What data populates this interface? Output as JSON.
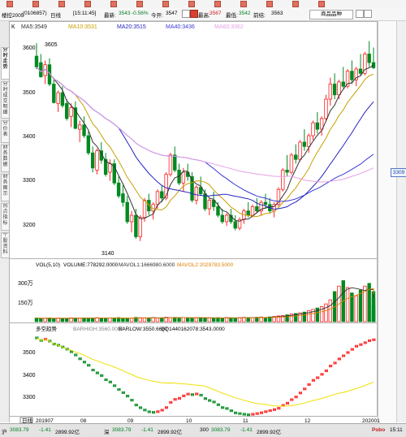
{
  "infobar": {
    "code": "楼控2005",
    "date_range": "(0106857)",
    "period": "日线",
    "time": "[15:11:45]",
    "latest_label": "最新:",
    "latest": "3543",
    "change": "-0.56%",
    "open_label": "今开:",
    "open": "3547",
    "high_label": "最高:",
    "high": "3567",
    "low_label": "最低:",
    "low": "3542",
    "prev_label": "前结:",
    "prev": "3563",
    "products_button": "商品品种"
  },
  "sidebar_tabs": [
    "分时走势",
    "分时成交明细",
    "分价表",
    "财务数据",
    "财务图示",
    "热点指标",
    "个股资料"
  ],
  "price_tag": "3309",
  "colors": {
    "up": "#ff2020",
    "down": "#008a20",
    "ma5": "#333333",
    "ma10": "#c8a000",
    "ma20": "#2424c0",
    "ma40": "#3a3ad8",
    "ma60": "#e6a0e6",
    "vol_ma1": "#303030",
    "vol_ma2": "#e08000",
    "barhigh": "#f0e000"
  },
  "chart_data": [
    {
      "type": "candlestick",
      "legend": {
        "k": "K",
        "ma5": "MA5:3549",
        "ma10": "MA10:3531",
        "ma20": "MA20:3515",
        "ma40": "MA40:3436",
        "ma60": "MA60:3362"
      },
      "y_ticks": [
        "3600",
        "3500",
        "3400",
        "3300",
        "3200"
      ],
      "ylim": [
        3115,
        3625
      ],
      "annotations": {
        "high": "3605",
        "low": "3140"
      },
      "candles": [
        [
          3570,
          3600,
          3540,
          3545
        ],
        [
          3555,
          3575,
          3520,
          3522
        ],
        [
          3525,
          3560,
          3505,
          3550
        ],
        [
          3550,
          3565,
          3500,
          3505
        ],
        [
          3505,
          3520,
          3460,
          3462
        ],
        [
          3460,
          3490,
          3440,
          3485
        ],
        [
          3485,
          3500,
          3450,
          3455
        ],
        [
          3460,
          3470,
          3420,
          3425
        ],
        [
          3430,
          3460,
          3405,
          3450
        ],
        [
          3450,
          3465,
          3400,
          3402
        ],
        [
          3400,
          3420,
          3370,
          3410
        ],
        [
          3410,
          3430,
          3380,
          3385
        ],
        [
          3385,
          3395,
          3340,
          3345
        ],
        [
          3345,
          3360,
          3300,
          3310
        ],
        [
          3305,
          3355,
          3295,
          3350
        ],
        [
          3350,
          3370,
          3320,
          3328
        ],
        [
          3330,
          3345,
          3290,
          3295
        ],
        [
          3300,
          3330,
          3280,
          3320
        ],
        [
          3320,
          3330,
          3270,
          3275
        ],
        [
          3275,
          3290,
          3240,
          3245
        ],
        [
          3250,
          3270,
          3220,
          3230
        ],
        [
          3230,
          3245,
          3180,
          3185
        ],
        [
          3185,
          3210,
          3160,
          3200
        ],
        [
          3200,
          3215,
          3145,
          3150
        ],
        [
          3150,
          3200,
          3140,
          3195
        ],
        [
          3195,
          3240,
          3185,
          3235
        ],
        [
          3235,
          3250,
          3200,
          3210
        ],
        [
          3210,
          3230,
          3190,
          3225
        ],
        [
          3225,
          3260,
          3215,
          3255
        ],
        [
          3255,
          3270,
          3230,
          3240
        ],
        [
          3240,
          3300,
          3235,
          3295
        ],
        [
          3295,
          3345,
          3290,
          3340
        ],
        [
          3340,
          3360,
          3300,
          3305
        ],
        [
          3305,
          3320,
          3270,
          3275
        ],
        [
          3275,
          3310,
          3255,
          3300
        ],
        [
          3300,
          3320,
          3280,
          3290
        ],
        [
          3290,
          3300,
          3230,
          3235
        ],
        [
          3235,
          3270,
          3225,
          3265
        ],
        [
          3265,
          3290,
          3245,
          3250
        ],
        [
          3250,
          3260,
          3210,
          3215
        ],
        [
          3215,
          3240,
          3200,
          3235
        ],
        [
          3235,
          3255,
          3210,
          3220
        ],
        [
          3220,
          3230,
          3195,
          3200
        ],
        [
          3200,
          3215,
          3180,
          3185
        ],
        [
          3185,
          3205,
          3175,
          3200
        ],
        [
          3200,
          3215,
          3180,
          3185
        ],
        [
          3185,
          3200,
          3165,
          3170
        ],
        [
          3170,
          3195,
          3165,
          3190
        ],
        [
          3190,
          3215,
          3180,
          3210
        ],
        [
          3210,
          3230,
          3195,
          3200
        ],
        [
          3200,
          3225,
          3195,
          3220
        ],
        [
          3220,
          3240,
          3205,
          3210
        ],
        [
          3210,
          3235,
          3200,
          3230
        ],
        [
          3230,
          3250,
          3215,
          3225
        ],
        [
          3225,
          3240,
          3205,
          3210
        ],
        [
          3210,
          3230,
          3195,
          3225
        ],
        [
          3225,
          3265,
          3220,
          3260
        ],
        [
          3260,
          3310,
          3255,
          3305
        ],
        [
          3305,
          3340,
          3290,
          3300
        ],
        [
          3300,
          3345,
          3295,
          3340
        ],
        [
          3340,
          3365,
          3320,
          3330
        ],
        [
          3330,
          3375,
          3325,
          3370
        ],
        [
          3370,
          3400,
          3350,
          3360
        ],
        [
          3360,
          3390,
          3345,
          3385
        ],
        [
          3385,
          3420,
          3375,
          3415
        ],
        [
          3415,
          3440,
          3390,
          3400
        ],
        [
          3400,
          3430,
          3385,
          3425
        ],
        [
          3425,
          3480,
          3420,
          3470
        ],
        [
          3470,
          3520,
          3455,
          3505
        ],
        [
          3505,
          3530,
          3470,
          3480
        ],
        [
          3480,
          3515,
          3470,
          3510
        ],
        [
          3510,
          3545,
          3495,
          3500
        ],
        [
          3500,
          3540,
          3495,
          3535
        ],
        [
          3535,
          3560,
          3505,
          3515
        ],
        [
          3515,
          3545,
          3500,
          3540
        ],
        [
          3540,
          3575,
          3525,
          3530
        ],
        [
          3530,
          3580,
          3525,
          3575
        ],
        [
          3575,
          3605,
          3545,
          3555
        ],
        [
          3555,
          3590,
          3540,
          3543
        ]
      ]
    },
    {
      "type": "bar",
      "legend": {
        "vol": "VOL(5,10)",
        "volume": "VOLUME:778292.0000",
        "mavol1": "MAVOL1:1666980.6000",
        "mavol2": "MAVOL2:2029783.5000"
      },
      "y_ticks": [
        "300万",
        "150万"
      ],
      "ylim": [
        0,
        3800000
      ],
      "values": [
        260000,
        240000,
        250000,
        270000,
        230000,
        260000,
        250000,
        240000,
        280000,
        260000,
        250000,
        270000,
        240000,
        260000,
        290000,
        270000,
        250000,
        260000,
        280000,
        300000,
        270000,
        260000,
        250000,
        310000,
        290000,
        280000,
        270000,
        300000,
        260000,
        280000,
        320000,
        290000,
        310000,
        270000,
        300000,
        280000,
        260000,
        290000,
        300000,
        270000,
        280000,
        260000,
        290000,
        270000,
        300000,
        280000,
        260000,
        290000,
        310000,
        300000,
        280000,
        320000,
        340000,
        300000,
        350000,
        380000,
        420000,
        450000,
        500000,
        560000,
        600000,
        650000,
        700000,
        800000,
        900000,
        1000000,
        1100000,
        1300000,
        1600000,
        2200000,
        2600000,
        3000000,
        2500000,
        2100000,
        1900000,
        2300000,
        2600000,
        2800000,
        2200000,
        1700000,
        1200000,
        778292
      ]
    },
    {
      "type": "line",
      "legend": {
        "name": "多空趋势",
        "barhigh": "BARHIGH:3560.0000",
        "barlow": "BARLOW:3550.6667",
        "qq": "QQ1440162078:3543.0000"
      },
      "y_ticks": [
        "3500",
        "3400",
        "3300"
      ],
      "ylim": [
        3195,
        3560
      ]
    }
  ],
  "x_axis": {
    "labels": [
      "日线",
      "201907",
      "08",
      "09",
      "10",
      "11",
      "12",
      "202001"
    ]
  },
  "statusbar": {
    "items": [
      {
        "label": "沪",
        "value": "3083.79",
        "change": "-1.41",
        "amount": "2899.92亿"
      },
      {
        "label": "深",
        "value": "3083.79",
        "change": "-1.41",
        "amount": "2899.92亿"
      },
      {
        "label": "300",
        "value": "3083.79",
        "change": "-1.41",
        "amount": "2899.92亿"
      }
    ],
    "pobo": "Pobo",
    "clock": "15:11"
  }
}
